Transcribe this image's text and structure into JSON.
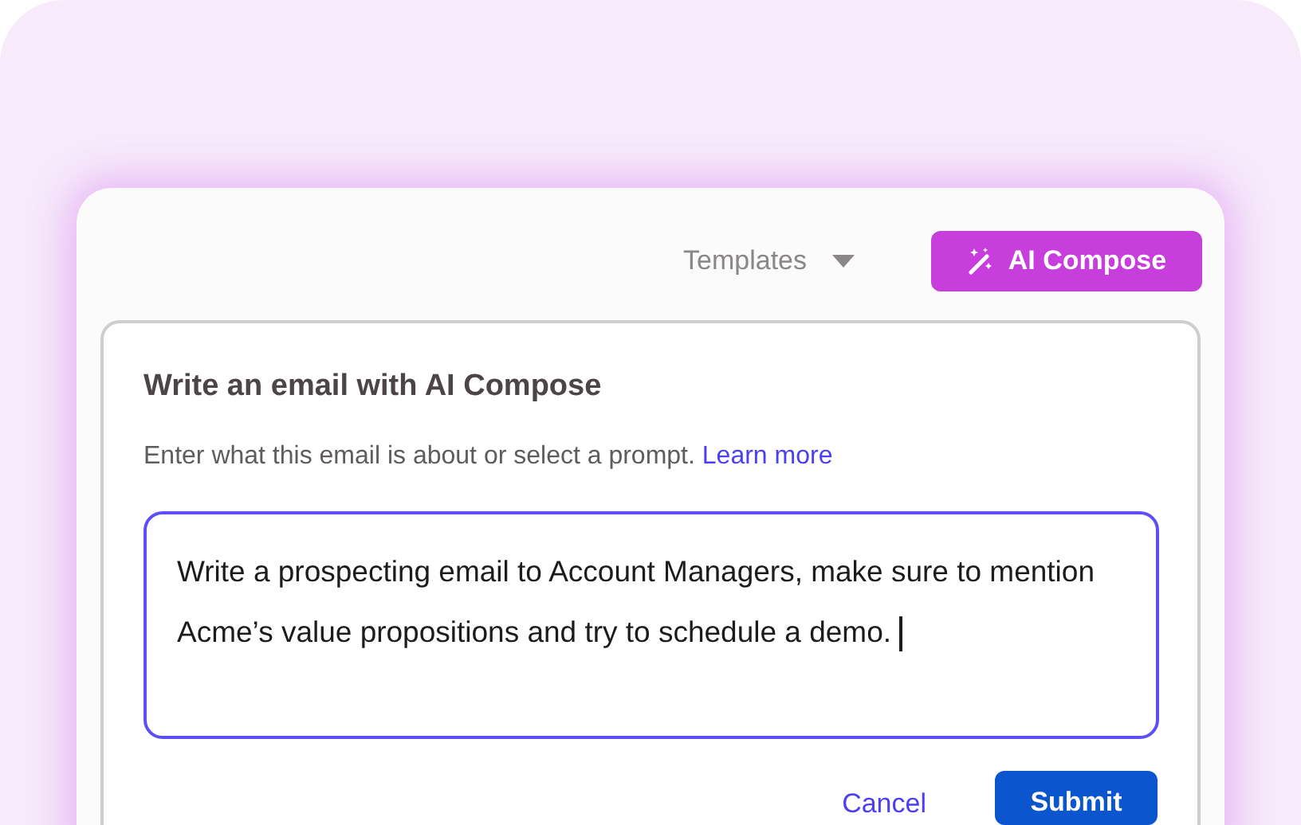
{
  "toolbar": {
    "templates_dropdown": "Templates",
    "ai_compose_button": "AI Compose"
  },
  "compose_panel": {
    "title": "Write an email with AI Compose",
    "description": "Enter what this email is about or select a prompt.",
    "learn_more_link": "Learn more",
    "prompt_field": {
      "value": "Write a prospecting email to Account Managers, make sure to mention Acme’s value propositions and try to schedule a demo.",
      "focused": true
    },
    "buttons": [
      {
        "label": "Cancel",
        "kind": "link"
      },
      {
        "label": "Submit",
        "kind": "primary"
      }
    ]
  }
}
